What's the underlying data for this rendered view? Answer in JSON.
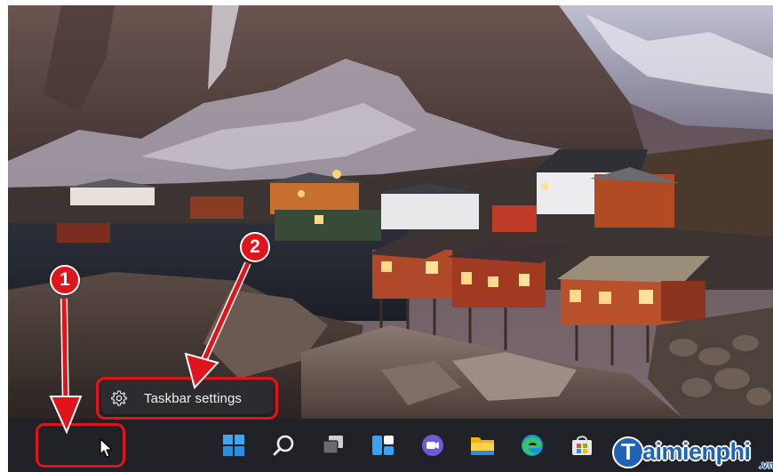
{
  "context_menu": {
    "label": "Taskbar settings",
    "icon": "gear-icon"
  },
  "annotations": {
    "step1": "1",
    "step2": "2",
    "highlight_color": "#e0141b"
  },
  "taskbar": {
    "background": "#1f2126",
    "icons": [
      "windows-start-icon",
      "search-icon",
      "task-view-icon",
      "widgets-icon",
      "chat-icon",
      "file-explorer-icon",
      "edge-browser-icon",
      "microsoft-store-icon"
    ]
  },
  "watermark": {
    "initial": "T",
    "text": "aimienphi",
    "suffix": ".vn"
  }
}
